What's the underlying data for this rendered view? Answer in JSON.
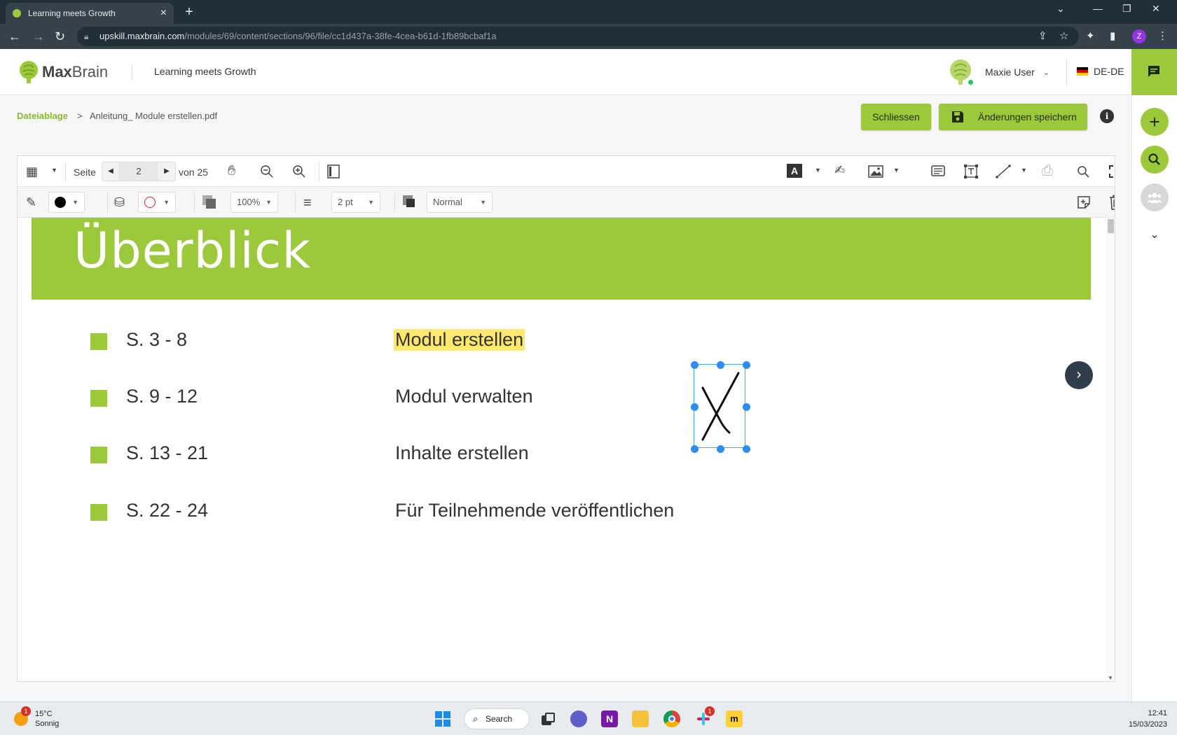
{
  "browser": {
    "tab_title": "Learning meets Growth",
    "url_host": "upskill.maxbrain.com",
    "url_path": "/modules/69/content/sections/96/file/cc1d437a-38fe-4cea-b61d-1fb89bcbaf1a",
    "profile_initial": "Z"
  },
  "header": {
    "brand_bold": "Max",
    "brand_rest": "Brain",
    "slogan": "Learning meets Growth",
    "user_name": "Maxie User",
    "language": "DE-DE"
  },
  "breadcrumb": {
    "root": "Dateiablage",
    "separator": ">",
    "current": "Anleitung_ Module erstellen.pdf"
  },
  "actions": {
    "close_label": "Schliessen",
    "save_label": "Änderungen speichern"
  },
  "toolbar": {
    "page_label": "Seite",
    "current_page": "2",
    "total_label": "von 25",
    "opacity": "100%",
    "stroke_width": "2 pt",
    "blend_mode": "Normal"
  },
  "document": {
    "heading": "Überblick",
    "rows": [
      {
        "pages": "S. 3 - 8",
        "topic": "Modul erstellen",
        "highlighted": true
      },
      {
        "pages": "S. 9 - 12",
        "topic": "Modul verwalten",
        "highlighted": false
      },
      {
        "pages": "S. 13 - 21",
        "topic": "Inhalte erstellen",
        "highlighted": false
      },
      {
        "pages": "S. 22 - 24",
        "topic": "Für Teilnehmende veröffentlichen",
        "highlighted": false
      }
    ]
  },
  "taskbar": {
    "temperature": "15°C",
    "condition": "Sonnig",
    "weather_badge": "1",
    "search_label": "Search",
    "slack_badge": "1",
    "time": "12:41",
    "date": "15/03/2023"
  },
  "colors": {
    "brand_green": "#9cc83c",
    "highlight_yellow": "#ffe872",
    "selection_blue": "#2f8cf0"
  }
}
